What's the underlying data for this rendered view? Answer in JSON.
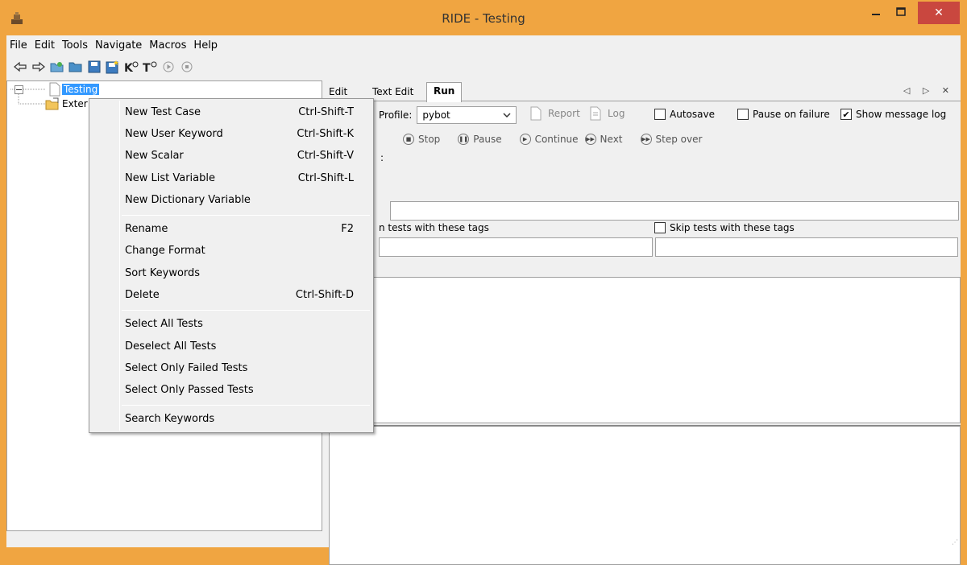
{
  "window": {
    "title": "RIDE - Testing",
    "minimize": "_",
    "maximize": "□",
    "close": "✕"
  },
  "menubar": {
    "items": [
      "File",
      "Edit",
      "Tools",
      "Navigate",
      "Macros",
      "Help"
    ]
  },
  "toolbar": {
    "icons": [
      "arrow-left-icon",
      "arrow-right-icon",
      "open-directory-icon",
      "open-folder-icon",
      "save-icon",
      "save-all-icon",
      "search-keywords-icon",
      "search-tests-icon",
      "run-icon",
      "stop-icon"
    ],
    "keyword_letter": "K",
    "test_letter": "T"
  },
  "tree": {
    "root": "Testing",
    "child": "Exter"
  },
  "tabs": {
    "edit": "Edit",
    "text_edit": "Text Edit",
    "run": "Run",
    "controls": "◁ ▷ ✕"
  },
  "run": {
    "profile_label": "Profile:",
    "profile_value": "pybot",
    "report": "Report",
    "log": "Log",
    "autosave": "Autosave",
    "pause_on_failure": "Pause on failure",
    "show_message_log": "Show message log",
    "stop": "Stop",
    "pause": "Pause",
    "continue": "Continue",
    "next": "Next",
    "step_over": "Step over",
    "args_label_fragment": ":",
    "run_tags_fragment": "n tests with these tags",
    "skip_tags": "Skip tests with these tags"
  },
  "context_menu": {
    "items": [
      {
        "label": "New Test Case",
        "shortcut": "Ctrl-Shift-T"
      },
      {
        "label": "New User Keyword",
        "shortcut": "Ctrl-Shift-K"
      },
      {
        "label": "New Scalar",
        "shortcut": "Ctrl-Shift-V"
      },
      {
        "label": "New List Variable",
        "shortcut": "Ctrl-Shift-L"
      },
      {
        "label": "New Dictionary Variable",
        "shortcut": ""
      },
      {
        "label": "Rename",
        "shortcut": "F2"
      },
      {
        "label": "Change Format",
        "shortcut": ""
      },
      {
        "label": "Sort Keywords",
        "shortcut": ""
      },
      {
        "label": "Delete",
        "shortcut": "Ctrl-Shift-D"
      },
      {
        "label": "Select All Tests",
        "shortcut": ""
      },
      {
        "label": "Deselect All Tests",
        "shortcut": ""
      },
      {
        "label": "Select Only Failed Tests",
        "shortcut": ""
      },
      {
        "label": "Select Only Passed Tests",
        "shortcut": ""
      },
      {
        "label": "Search Keywords",
        "shortcut": ""
      }
    ]
  },
  "colors": {
    "titlebar": "#f0a541",
    "close_button": "#c9473f",
    "selection": "#3399ff"
  }
}
